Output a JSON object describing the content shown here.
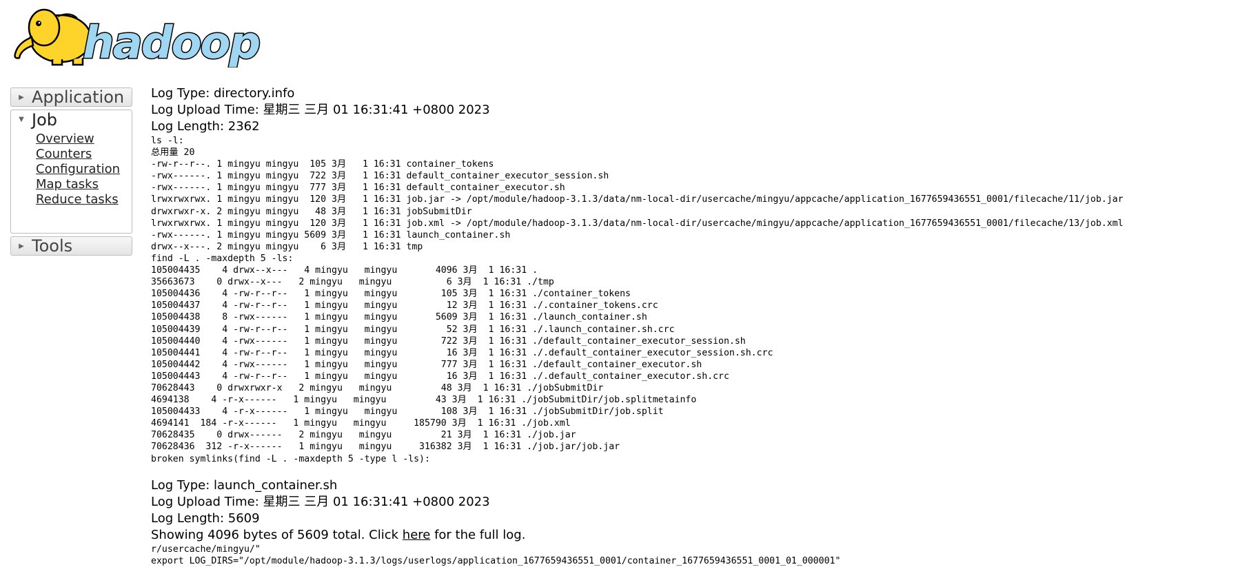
{
  "logo": {
    "text": "hadoop",
    "colors": {
      "elephant": "#ffd42a",
      "text": "#9fd6f2",
      "outline": "#000000"
    }
  },
  "nav": {
    "application": {
      "label": "Application"
    },
    "job": {
      "label": "Job",
      "items": [
        {
          "label": "Overview"
        },
        {
          "label": "Counters"
        },
        {
          "label": "Configuration"
        },
        {
          "label": "Map tasks"
        },
        {
          "label": "Reduce tasks"
        }
      ]
    },
    "tools": {
      "label": "Tools"
    }
  },
  "logs": [
    {
      "type": "Log Type: directory.info",
      "upload": "Log Upload Time: 星期三 三月 01 16:31:41 +0800 2023",
      "length": "Log Length: 2362",
      "content": "ls -l:\n总用量 20\n-rw-r--r--. 1 mingyu mingyu  105 3月   1 16:31 container_tokens\n-rwx------. 1 mingyu mingyu  722 3月   1 16:31 default_container_executor_session.sh\n-rwx------. 1 mingyu mingyu  777 3月   1 16:31 default_container_executor.sh\nlrwxrwxrwx. 1 mingyu mingyu  120 3月   1 16:31 job.jar -> /opt/module/hadoop-3.1.3/data/nm-local-dir/usercache/mingyu/appcache/application_1677659436551_0001/filecache/11/job.jar\ndrwxrwxr-x. 2 mingyu mingyu   48 3月   1 16:31 jobSubmitDir\nlrwxrwxrwx. 1 mingyu mingyu  120 3月   1 16:31 job.xml -> /opt/module/hadoop-3.1.3/data/nm-local-dir/usercache/mingyu/appcache/application_1677659436551_0001/filecache/13/job.xml\n-rwx------. 1 mingyu mingyu 5609 3月   1 16:31 launch_container.sh\ndrwx--x---. 2 mingyu mingyu    6 3月   1 16:31 tmp\nfind -L . -maxdepth 5 -ls:\n105004435    4 drwx--x---   4 mingyu   mingyu       4096 3月  1 16:31 .\n35663673    0 drwx--x---   2 mingyu   mingyu          6 3月  1 16:31 ./tmp\n105004436    4 -rw-r--r--   1 mingyu   mingyu        105 3月  1 16:31 ./container_tokens\n105004437    4 -rw-r--r--   1 mingyu   mingyu         12 3月  1 16:31 ./.container_tokens.crc\n105004438    8 -rwx------   1 mingyu   mingyu       5609 3月  1 16:31 ./launch_container.sh\n105004439    4 -rw-r--r--   1 mingyu   mingyu         52 3月  1 16:31 ./.launch_container.sh.crc\n105004440    4 -rwx------   1 mingyu   mingyu        722 3月  1 16:31 ./default_container_executor_session.sh\n105004441    4 -rw-r--r--   1 mingyu   mingyu         16 3月  1 16:31 ./.default_container_executor_session.sh.crc\n105004442    4 -rwx------   1 mingyu   mingyu        777 3月  1 16:31 ./default_container_executor.sh\n105004443    4 -rw-r--r--   1 mingyu   mingyu         16 3月  1 16:31 ./.default_container_executor.sh.crc\n70628443    0 drwxrwxr-x   2 mingyu   mingyu         48 3月  1 16:31 ./jobSubmitDir\n4694138    4 -r-x------   1 mingyu   mingyu         43 3月  1 16:31 ./jobSubmitDir/job.splitmetainfo\n105004433    4 -r-x------   1 mingyu   mingyu        108 3月  1 16:31 ./jobSubmitDir/job.split\n4694141  184 -r-x------   1 mingyu   mingyu     185790 3月  1 16:31 ./job.xml\n70628435    0 drwx------   2 mingyu   mingyu         21 3月  1 16:31 ./job.jar\n70628436  312 -r-x------   1 mingyu   mingyu     316382 3月  1 16:31 ./job.jar/job.jar\nbroken symlinks(find -L . -maxdepth 5 -type l -ls):"
    },
    {
      "type": "Log Type: launch_container.sh",
      "upload": "Log Upload Time: 星期三 三月 01 16:31:41 +0800 2023",
      "length": "Log Length: 5609",
      "showing_prefix": "Showing 4096 bytes of 5609 total. Click ",
      "here_link": "here",
      "showing_suffix": " for the full log.",
      "content": "r/usercache/mingyu/\"\nexport LOG_DIRS=\"/opt/module/hadoop-3.1.3/logs/userlogs/application_1677659436551_0001/container_1677659436551_0001_01_000001\""
    }
  ]
}
